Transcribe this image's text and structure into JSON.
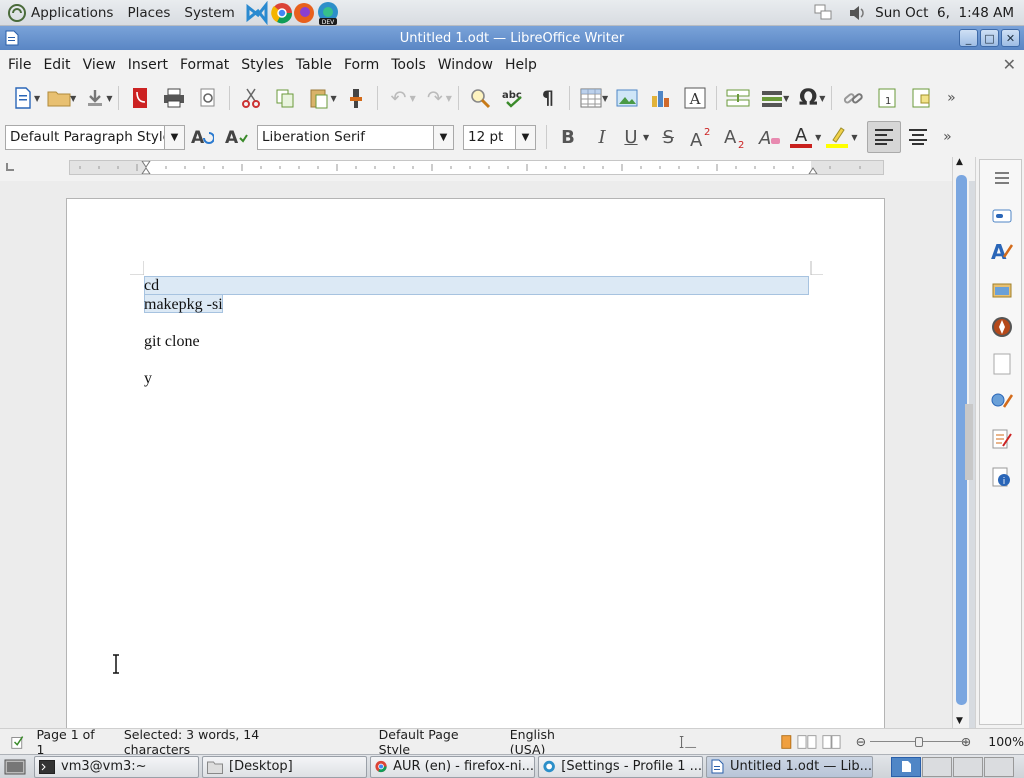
{
  "panel": {
    "applications": "Applications",
    "places": "Places",
    "system": "System",
    "clock": "Sun Oct  6,  1:48 AM"
  },
  "window": {
    "title": "Untitled 1.odt — LibreOffice Writer"
  },
  "menubar": [
    "File",
    "Edit",
    "View",
    "Insert",
    "Format",
    "Styles",
    "Table",
    "Form",
    "Tools",
    "Window",
    "Help"
  ],
  "formatting": {
    "paragraph_style": "Default Paragraph Style",
    "font_name": "Liberation Serif",
    "font_size": "12 pt",
    "bold": "B",
    "italic": "I",
    "underline": "U",
    "strikethrough": "S",
    "font_color_glyph": "A"
  },
  "document": {
    "lines": [
      "cd",
      "makepkg -si",
      "git clone",
      "y"
    ]
  },
  "statusbar": {
    "page": "Page 1 of 1",
    "selection": "Selected: 3 words, 14 characters",
    "page_style": "Default Page Style",
    "language": "English (USA)",
    "zoom": "100%"
  },
  "taskbar": [
    {
      "label": "vm3@vm3:~"
    },
    {
      "label": "[Desktop]"
    },
    {
      "label": "AUR (en) - firefox-ni..."
    },
    {
      "label": "[Settings - Profile 1 ..."
    },
    {
      "label": "Untitled 1.odt — Lib..."
    }
  ],
  "colors": {
    "titlebar": "#5a86c4",
    "selection": "#dce9f5",
    "font_color": "#c9211e",
    "highlight": "#ffff00"
  }
}
